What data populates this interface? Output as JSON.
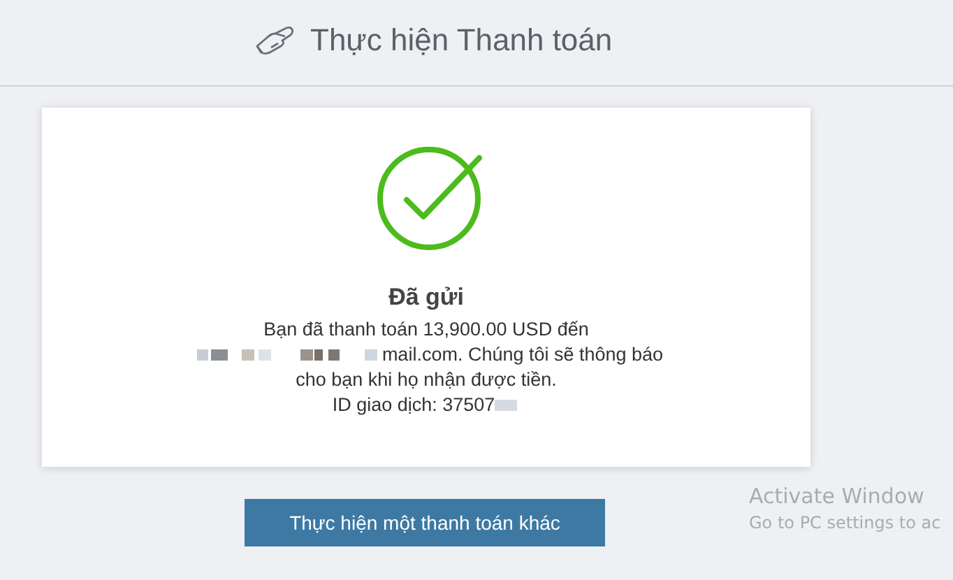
{
  "header": {
    "title": "Thực hiện Thanh toán"
  },
  "result": {
    "title": "Đã gửi",
    "lines": [
      {
        "kind": "plain",
        "text": "Bạn đã thanh toán 13,900.00 USD đến"
      },
      {
        "kind": "redacted_start",
        "text": "mail.com. Chúng tôi sẽ thông báo"
      },
      {
        "kind": "plain",
        "text": "cho bạn khi họ nhận được tiền."
      },
      {
        "kind": "redacted_end",
        "text": "ID giao dịch: 37507"
      }
    ]
  },
  "button": {
    "label": "Thực hiện một thanh toán khác"
  },
  "os_overlay": {
    "title": "Activate Window",
    "subtitle": "Go to PC settings to ac"
  }
}
